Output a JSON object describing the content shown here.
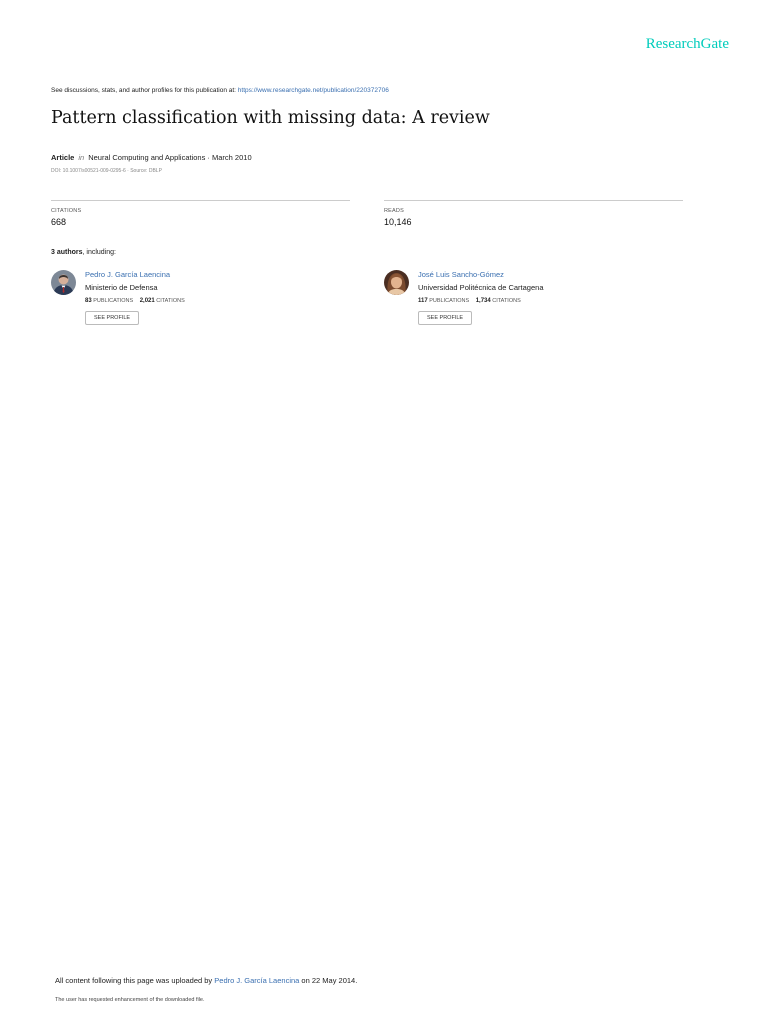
{
  "header": {
    "brand": "ResearchGate",
    "discussions_text": "See discussions, stats, and author profiles for this publication at: ",
    "publication_url": "https://www.researchgate.net/publication/220372706"
  },
  "publication": {
    "title": "Pattern classification with missing data: A review",
    "type": "Article",
    "in_word": "in",
    "venue_date": "Neural Computing and Applications · March 2010",
    "doi_source": "DOI: 10.1007/s00521-009-0295-6 · Source: DBLP"
  },
  "stats": {
    "citations_label": "CITATIONS",
    "citations_value": "668",
    "reads_label": "READS",
    "reads_value": "10,146"
  },
  "authors_heading": {
    "count": "3 authors",
    "suffix": ", including:"
  },
  "authors": [
    {
      "name": "Pedro J. García Laencina",
      "institution": "Ministerio de Defensa",
      "publications": "83",
      "publications_label": "PUBLICATIONS",
      "citations": "2,021",
      "citations_label": "CITATIONS",
      "button": "SEE PROFILE"
    },
    {
      "name": "José Luis Sancho-Gómez",
      "institution": "Universidad Politécnica de Cartagena",
      "publications": "117",
      "publications_label": "PUBLICATIONS",
      "citations": "1,734",
      "citations_label": "CITATIONS",
      "button": "SEE PROFILE"
    }
  ],
  "footer": {
    "upload_prefix": "All content following this page was uploaded by ",
    "uploader": "Pedro J. García Laencina",
    "upload_suffix": " on 22 May 2014.",
    "note": "The user has requested enhancement of the downloaded file."
  },
  "colors": {
    "brand": "#00ccbb",
    "link": "#3a6fb0"
  }
}
